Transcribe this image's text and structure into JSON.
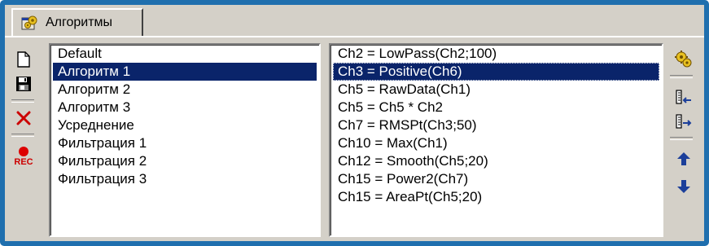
{
  "tab": {
    "label": "Алгоритмы",
    "icon": "gears-icon"
  },
  "left_toolbar": {
    "new_icon": "new-document-icon",
    "save_icon": "save-icon",
    "delete_icon": "delete-x-icon",
    "record_icon": "record-icon",
    "record_label": "REC"
  },
  "algorithms": [
    {
      "label": "Default",
      "selected": false
    },
    {
      "label": "Алгоритм 1",
      "selected": true
    },
    {
      "label": "Алгоритм 2",
      "selected": false
    },
    {
      "label": "Алгоритм 3",
      "selected": false
    },
    {
      "label": "Усреднение",
      "selected": false
    },
    {
      "label": "Фильтрация 1",
      "selected": false
    },
    {
      "label": "Фильтрация 2",
      "selected": false
    },
    {
      "label": "Фильтрация 3",
      "selected": false
    }
  ],
  "formulas": [
    {
      "label": "Ch2 = LowPass(Ch2;100)",
      "selected": false
    },
    {
      "label": "Ch3 = Positive(Ch6)",
      "selected": true
    },
    {
      "label": "Ch5 = RawData(Ch1)",
      "selected": false
    },
    {
      "label": "Ch5 = Ch5 * Ch2",
      "selected": false
    },
    {
      "label": "Ch7 = RMSPt(Ch3;50)",
      "selected": false
    },
    {
      "label": "Ch10 = Max(Ch1)",
      "selected": false
    },
    {
      "label": "Ch12 = Smooth(Ch5;20)",
      "selected": false
    },
    {
      "label": "Ch15 = Power2(Ch7)",
      "selected": false
    },
    {
      "label": "Ch15 = AreaPt(Ch5;20)",
      "selected": false
    }
  ],
  "right_toolbar": {
    "run_icon": "gear-run-icon",
    "insert_left_icon": "insert-left-icon",
    "insert_right_icon": "insert-right-icon",
    "move_up_icon": "arrow-up-icon",
    "move_down_icon": "arrow-down-icon"
  },
  "colors": {
    "frame": "#1f6fae",
    "panel": "#d4d0c8",
    "selection": "#0a246a",
    "delete_red": "#cc0000",
    "arrow_blue": "#1c3f9a",
    "gear_yellow": "#e8c020"
  }
}
